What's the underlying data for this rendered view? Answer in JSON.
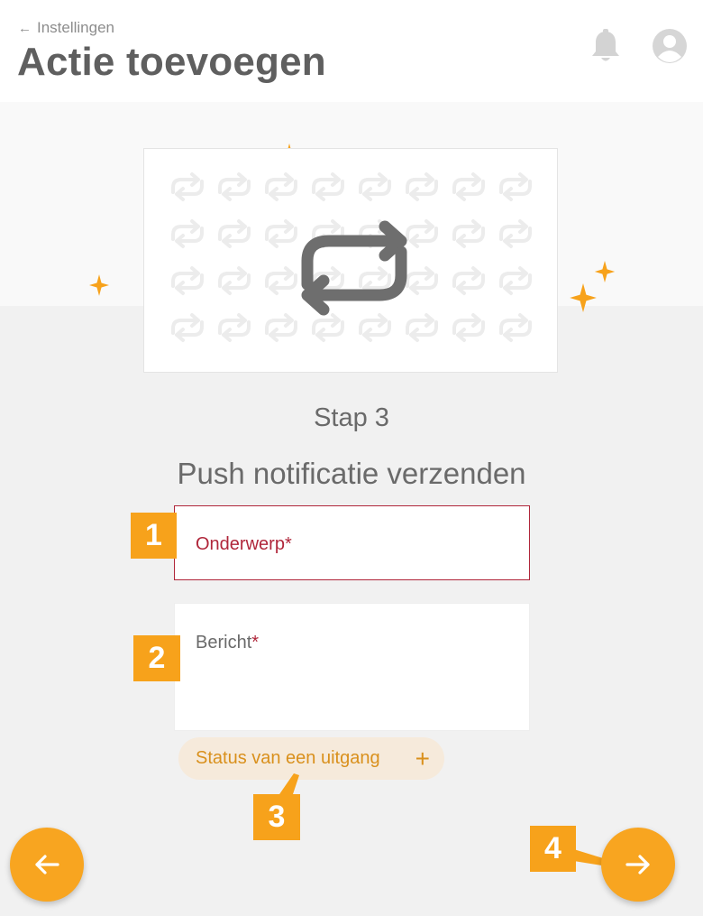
{
  "header": {
    "back_label": "Instellingen",
    "title": "Actie toevoegen",
    "icons": [
      "arrow-left-icon",
      "bell-icon",
      "user-avatar-icon"
    ]
  },
  "step": {
    "label": "Stap 3",
    "title": "Push notificatie verzenden"
  },
  "form": {
    "subject_label": "Onderwerp",
    "message_label": "Bericht",
    "required_marker": "*"
  },
  "chip": {
    "label": "Status van een uitgang",
    "icon": "plus-icon"
  },
  "badges": [
    "1",
    "2",
    "3",
    "4"
  ],
  "navigation": {
    "back_icon": "arrow-left-icon",
    "next_icon": "arrow-right-icon"
  },
  "colors": {
    "accent": "#f8a520",
    "error": "#b0263a",
    "chip_background": "#f6eadb",
    "text": "#5f5f5f"
  }
}
